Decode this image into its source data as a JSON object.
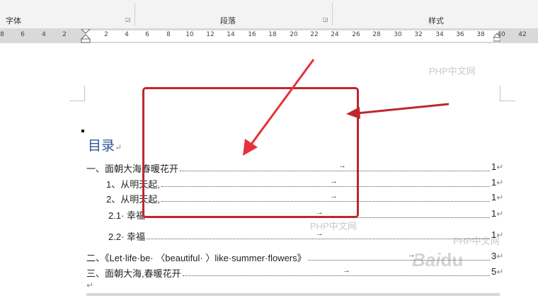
{
  "ribbon": {
    "groups": [
      {
        "label": "字体"
      },
      {
        "label": "段落"
      },
      {
        "label": "样式"
      }
    ]
  },
  "ruler": {
    "ticks": [
      "8",
      "6",
      "4",
      "2",
      "2",
      "4",
      "6",
      "8",
      "10",
      "12",
      "14",
      "16",
      "18",
      "20",
      "22",
      "24",
      "26",
      "28",
      "30",
      "32",
      "34",
      "36",
      "38",
      "40",
      "42"
    ]
  },
  "document": {
    "title": "目录",
    "return_mark": "↵",
    "tab_mark": "→",
    "toc": [
      {
        "text": "一、面朝大海春暖花开",
        "page": "1"
      },
      {
        "text": "1、从明天起,",
        "page": "1"
      },
      {
        "text": "2、从明天起,",
        "page": "1"
      },
      {
        "text": "2.1· 幸福",
        "page": "1"
      },
      {
        "text": "2.2· 幸福",
        "page": "1"
      },
      {
        "text": "二、《Let·life·be· 〈beautiful· 〉like·summer·flowers》",
        "page": "3"
      },
      {
        "text": "三、面朝大海,春暖花开",
        "page": "5"
      }
    ]
  },
  "watermarks": [
    "PHP中文网",
    "PHP中文网",
    "PHP中文网"
  ],
  "colors": {
    "annotation": "#c0262d",
    "heading": "#2d5597"
  }
}
